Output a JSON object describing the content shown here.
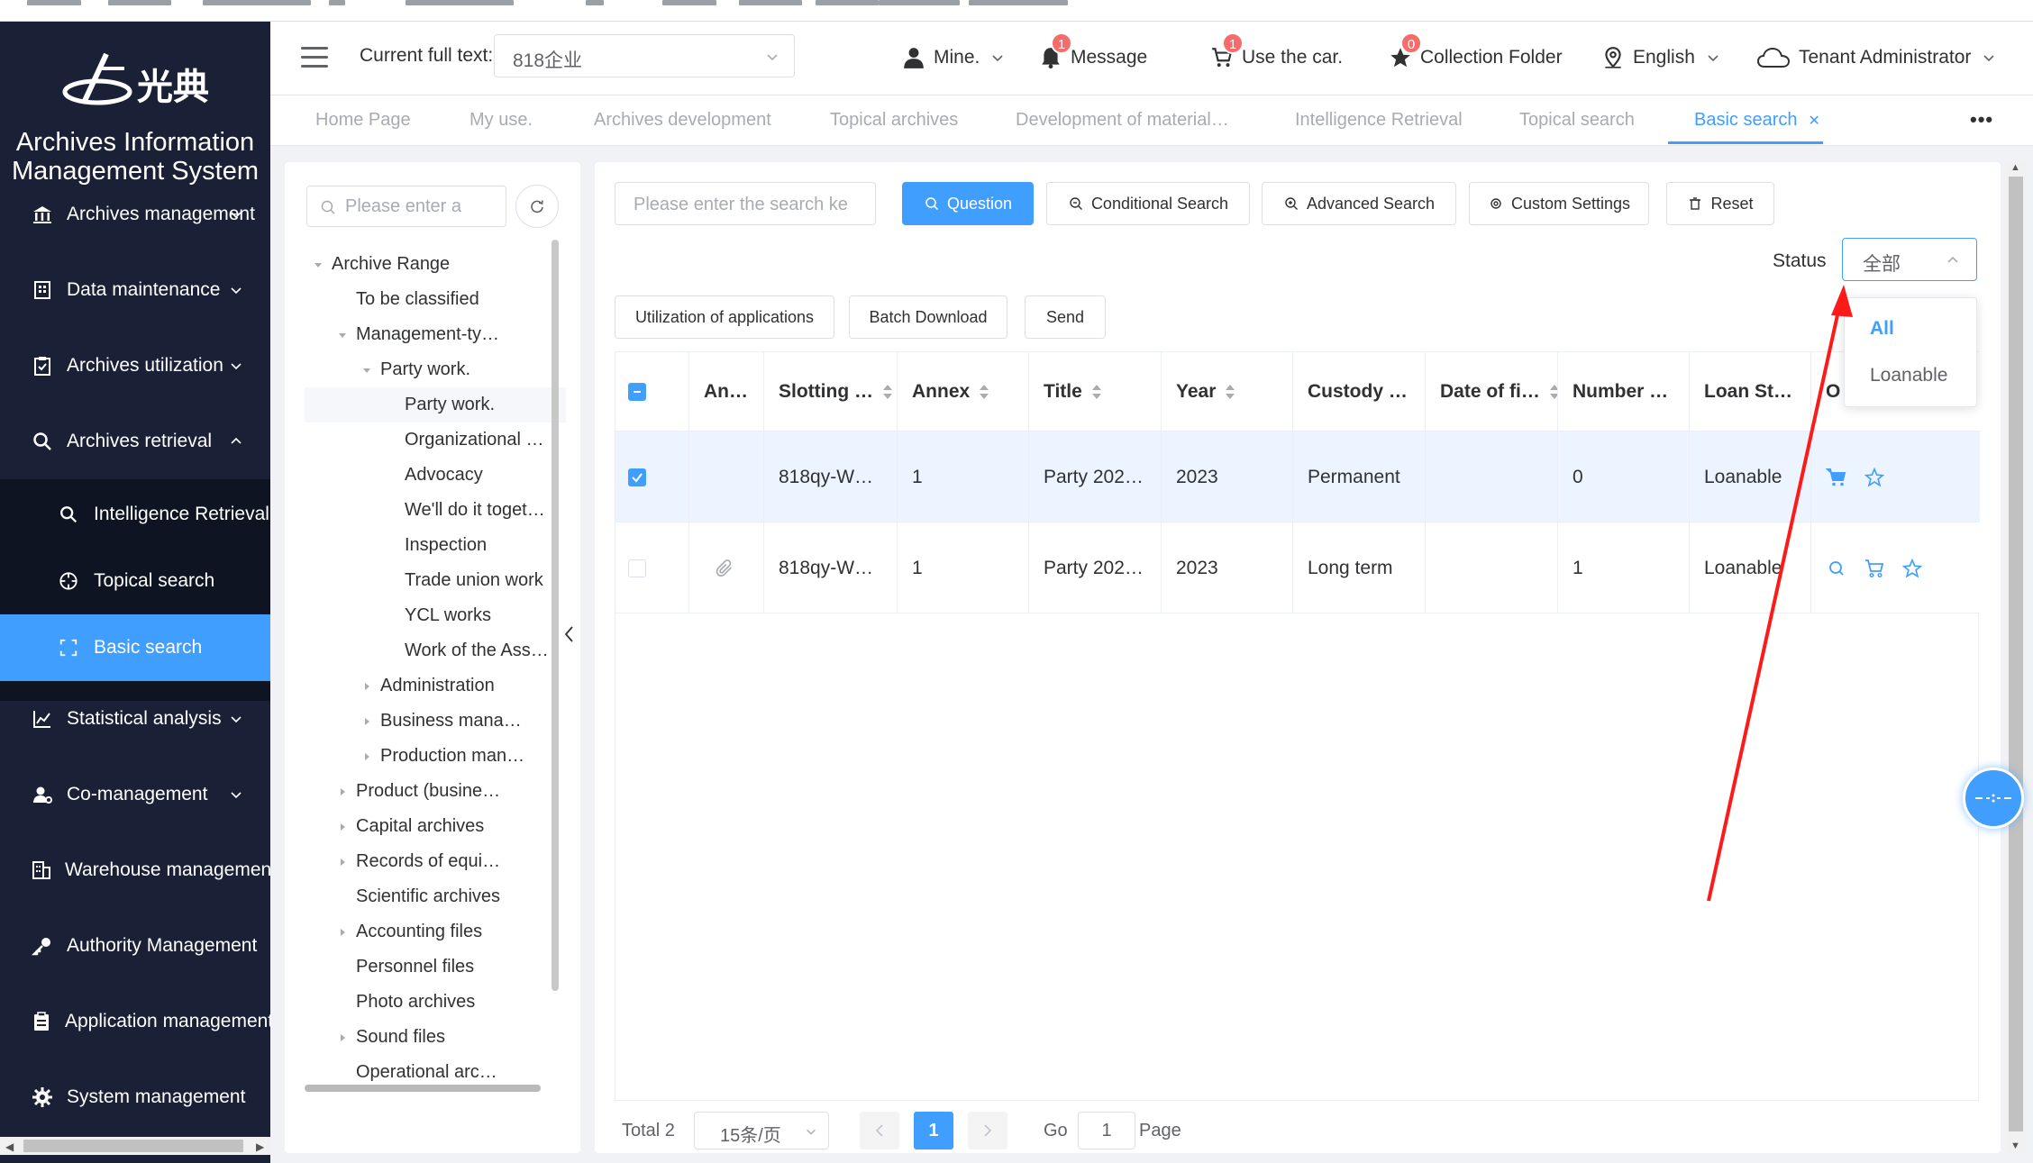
{
  "colors": {
    "accent": "#409eff",
    "sidebar_bg": "#1a2035",
    "sidebar_active": "#409eff",
    "badge": "#f56c6c",
    "annotation_arrow": "#ff1a1a"
  },
  "sidebar": {
    "title_line1": "Archives Information",
    "title_line2": "Management System",
    "logo_text": "光典",
    "items": [
      {
        "label": "Archives management",
        "icon": "bank-icon"
      },
      {
        "label": "Data maintenance",
        "icon": "building-icon"
      },
      {
        "label": "Archives utilization",
        "icon": "clipboard-check-icon"
      },
      {
        "label": "Archives retrieval",
        "icon": "search-icon",
        "expanded": true
      },
      {
        "label": "Statistical analysis",
        "icon": "line-chart-icon"
      },
      {
        "label": "Co-management",
        "icon": "user-gear-icon"
      },
      {
        "label": "Warehouse management",
        "icon": "office-building-icon"
      },
      {
        "label": "Authority Management",
        "icon": "key-icon"
      },
      {
        "label": "Application management",
        "icon": "clipboard-icon"
      },
      {
        "label": "System management",
        "icon": "gear-icon"
      }
    ],
    "subitems": [
      {
        "label": "Intelligence Retrieval",
        "icon": "search-icon"
      },
      {
        "label": "Topical search",
        "icon": "compass-icon"
      },
      {
        "label": "Basic search",
        "icon": "scan-icon",
        "active": true
      }
    ]
  },
  "header": {
    "full_text_label": "Current full text:",
    "full_text_value": "818企业",
    "mine": "Mine.",
    "message": "Message",
    "message_badge": "1",
    "use_car": "Use the car.",
    "use_car_badge": "1",
    "collection": "Collection Folder",
    "collection_badge": "0",
    "language": "English",
    "tenant": "Tenant Administrator"
  },
  "tabs": [
    {
      "label": "Home Page"
    },
    {
      "label": "My use."
    },
    {
      "label": "Archives development"
    },
    {
      "label": "Topical archives"
    },
    {
      "label": "Development of material…"
    },
    {
      "label": "Intelligence Retrieval"
    },
    {
      "label": "Topical search"
    },
    {
      "label": "Basic search",
      "active": true
    }
  ],
  "tabs_more": "•••",
  "tree": {
    "search_placeholder": "Please enter a",
    "nodes": [
      {
        "label": "Archive Range",
        "level": 0,
        "caret": "open"
      },
      {
        "label": "To be classified",
        "level": 1,
        "caret": "none"
      },
      {
        "label": "Management-ty…",
        "level": 1,
        "caret": "open"
      },
      {
        "label": "Party work.",
        "level": 2,
        "caret": "open"
      },
      {
        "label": "Party work.",
        "level": 3,
        "caret": "none",
        "selected": true
      },
      {
        "label": "Organizational …",
        "level": 3,
        "caret": "none"
      },
      {
        "label": "Advocacy",
        "level": 3,
        "caret": "none"
      },
      {
        "label": "We'll do it toget…",
        "level": 3,
        "caret": "none"
      },
      {
        "label": "Inspection",
        "level": 3,
        "caret": "none"
      },
      {
        "label": "Trade union work",
        "level": 3,
        "caret": "none"
      },
      {
        "label": "YCL works",
        "level": 3,
        "caret": "none"
      },
      {
        "label": "Work of the Ass…",
        "level": 3,
        "caret": "none"
      },
      {
        "label": "Administration",
        "level": 2,
        "caret": "closed"
      },
      {
        "label": "Business mana…",
        "level": 2,
        "caret": "closed"
      },
      {
        "label": "Production man…",
        "level": 2,
        "caret": "closed"
      },
      {
        "label": "Product (busine…",
        "level": 1,
        "caret": "closed"
      },
      {
        "label": "Capital archives",
        "level": 1,
        "caret": "closed"
      },
      {
        "label": "Records of equi…",
        "level": 1,
        "caret": "closed"
      },
      {
        "label": "Scientific archives",
        "level": 1,
        "caret": "none"
      },
      {
        "label": "Accounting files",
        "level": 1,
        "caret": "closed"
      },
      {
        "label": "Personnel files",
        "level": 1,
        "caret": "none"
      },
      {
        "label": "Photo archives",
        "level": 1,
        "caret": "none"
      },
      {
        "label": "Sound files",
        "level": 1,
        "caret": "closed"
      },
      {
        "label": "Operational arc…",
        "level": 1,
        "caret": "none"
      }
    ]
  },
  "toolbar": {
    "keyword_placeholder": "Please enter the search ke",
    "question": "Question",
    "conditional": "Conditional Search",
    "advanced": "Advanced Search",
    "custom": "Custom Settings",
    "reset": "Reset",
    "status_label": "Status",
    "status_value": "全部",
    "utilization": "Utilization of applications",
    "batch_download": "Batch Download",
    "send": "Send"
  },
  "status_options": [
    {
      "label": "All",
      "selected": true
    },
    {
      "label": "Loanable",
      "selected": false
    }
  ],
  "table": {
    "columns": [
      "An…",
      "Slotting …",
      "Annex",
      "Title",
      "Year",
      "Custody …",
      "Date of fi…",
      "Number …",
      "Loan St…",
      "O"
    ],
    "rows": [
      {
        "checked": true,
        "attachment": false,
        "slotting": "818qy-W…",
        "annex": "1",
        "title": "Party 202…",
        "year": "2023",
        "custody": "Permanent",
        "date": "",
        "number": "0",
        "loan": "Loanable",
        "ops": [
          "cart-filled-icon",
          "star-icon"
        ]
      },
      {
        "checked": false,
        "attachment": true,
        "slotting": "818qy-W…",
        "annex": "1",
        "title": "Party 202…",
        "year": "2023",
        "custody": "Long term",
        "date": "",
        "number": "1",
        "loan": "Loanable",
        "ops": [
          "search-icon",
          "cart-icon",
          "star-icon"
        ]
      }
    ]
  },
  "pagination": {
    "total": "Total 2",
    "page_size": "15条/页",
    "current": "1",
    "go": "Go",
    "go_value": "1",
    "page": "Page"
  }
}
